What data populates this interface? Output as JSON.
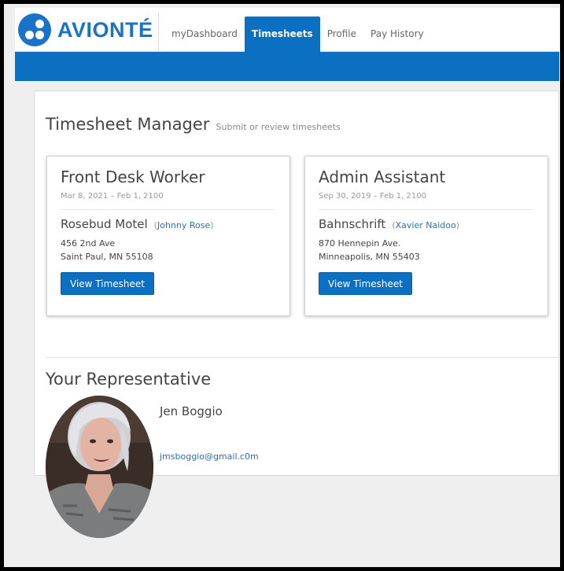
{
  "brand": {
    "name": "AVIONTÉ"
  },
  "nav": {
    "items": [
      {
        "label": "myDashboard",
        "active": false
      },
      {
        "label": "Timesheets",
        "active": true
      },
      {
        "label": "Profile",
        "active": false
      },
      {
        "label": "Pay History",
        "active": false
      }
    ]
  },
  "colors": {
    "primary": "#0b6fc2",
    "link": "#2f6fae"
  },
  "page": {
    "title": "Timesheet Manager",
    "subtitle": "Submit or review timesheets"
  },
  "assignments": [
    {
      "job_title": "Front Desk Worker",
      "dates": "Mar 8, 2021 – Feb 1, 2100",
      "company": "Rosebud Motel",
      "contact_open": "(",
      "contact": "Johnny Rose",
      "contact_close": ")",
      "address_line1": "456 2nd Ave",
      "address_line2": "Saint Paul, MN 55108",
      "button_label": "View Timesheet"
    },
    {
      "job_title": "Admin Assistant",
      "dates": "Sep 30, 2019 – Feb 1, 2100",
      "company": "Bahnschrift",
      "contact_open": "(",
      "contact": "Xavier Naidoo",
      "contact_close": ")",
      "address_line1": "870 Hennepin Ave.",
      "address_line2": "Minneapolis, MN 55403",
      "button_label": "View Timesheet"
    }
  ],
  "representative": {
    "heading": "Your Representative",
    "name": "Jen Boggio",
    "email": "jmsboggio@gmail.c0m",
    "photo_icon": "avatar-photo"
  }
}
